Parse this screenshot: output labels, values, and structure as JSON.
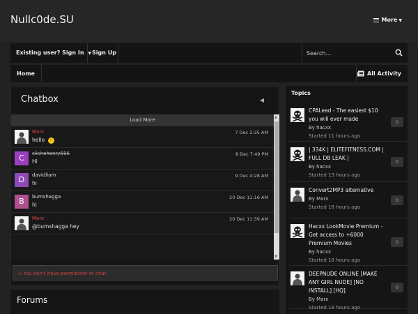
{
  "site": {
    "title": "Nullc0de.SU",
    "more_label": "More"
  },
  "userbar": {
    "signin": "Existing user? Sign In",
    "signup": "Sign Up",
    "search_placeholder": "Search..."
  },
  "nav": {
    "home": "Home",
    "all_activity": "All Activity"
  },
  "chatbox": {
    "title": "Chatbox",
    "load_more": "Load More",
    "messages": [
      {
        "author": "Marx",
        "text": "hello",
        "time": "7 Dec 2:35 AM",
        "avatar_letter": "",
        "avatar_color": "#ffffff",
        "name_color": "#e84b4b"
      },
      {
        "author": "clichehenry686",
        "text": "Hi",
        "time": "8 Dec 7:49 PM",
        "avatar_letter": "C",
        "avatar_color": "#9c3fbf",
        "name_color": "#aaaaaa"
      },
      {
        "author": "davidliam",
        "text": "hi",
        "time": "9 Dec 4:28 AM",
        "avatar_letter": "D",
        "avatar_color": "#8e4bb8",
        "name_color": "#dddddd"
      },
      {
        "author": "bumshagga",
        "text": "hi",
        "time": "20 Dec 11:16 AM",
        "avatar_letter": "B",
        "avatar_color": "#b0508e",
        "name_color": "#dddddd"
      },
      {
        "author": "Marx",
        "text": "@bumshagga hey",
        "time": "20 Dec 11:39 AM",
        "avatar_letter": "",
        "avatar_color": "#ffffff",
        "name_color": "#e84b4b"
      }
    ],
    "permission_msg": "You don't have permission to chat."
  },
  "forums": {
    "title": "Forums"
  },
  "topics": {
    "title": "Topics",
    "items": [
      {
        "title": "CPALead - The easiest $10 you will ever made",
        "by": "By hacxx",
        "ago": "Started 11 hours ago",
        "count": "0"
      },
      {
        "title": "| 334K | ELITEFITNESS.COM | FULL DB LEAK |",
        "by": "By hacxx",
        "ago": "Started 13 hours ago",
        "count": "0"
      },
      {
        "title": "Convert2MP3 alternative",
        "by": "By Marx",
        "ago": "Started 18 hours ago",
        "count": "0"
      },
      {
        "title": "Hacxx LookMovie Premium - Get access to +6000 Premium Movies",
        "by": "By hacxx",
        "ago": "Started 18 hours ago",
        "count": "0"
      },
      {
        "title": "DEEPNUDE ONLINE [MAKE ANY GIRL NUDE] [NO INSTALL] [HQ]",
        "by": "By Marx",
        "ago": "Started 18 hours ago",
        "count": "0"
      }
    ]
  }
}
